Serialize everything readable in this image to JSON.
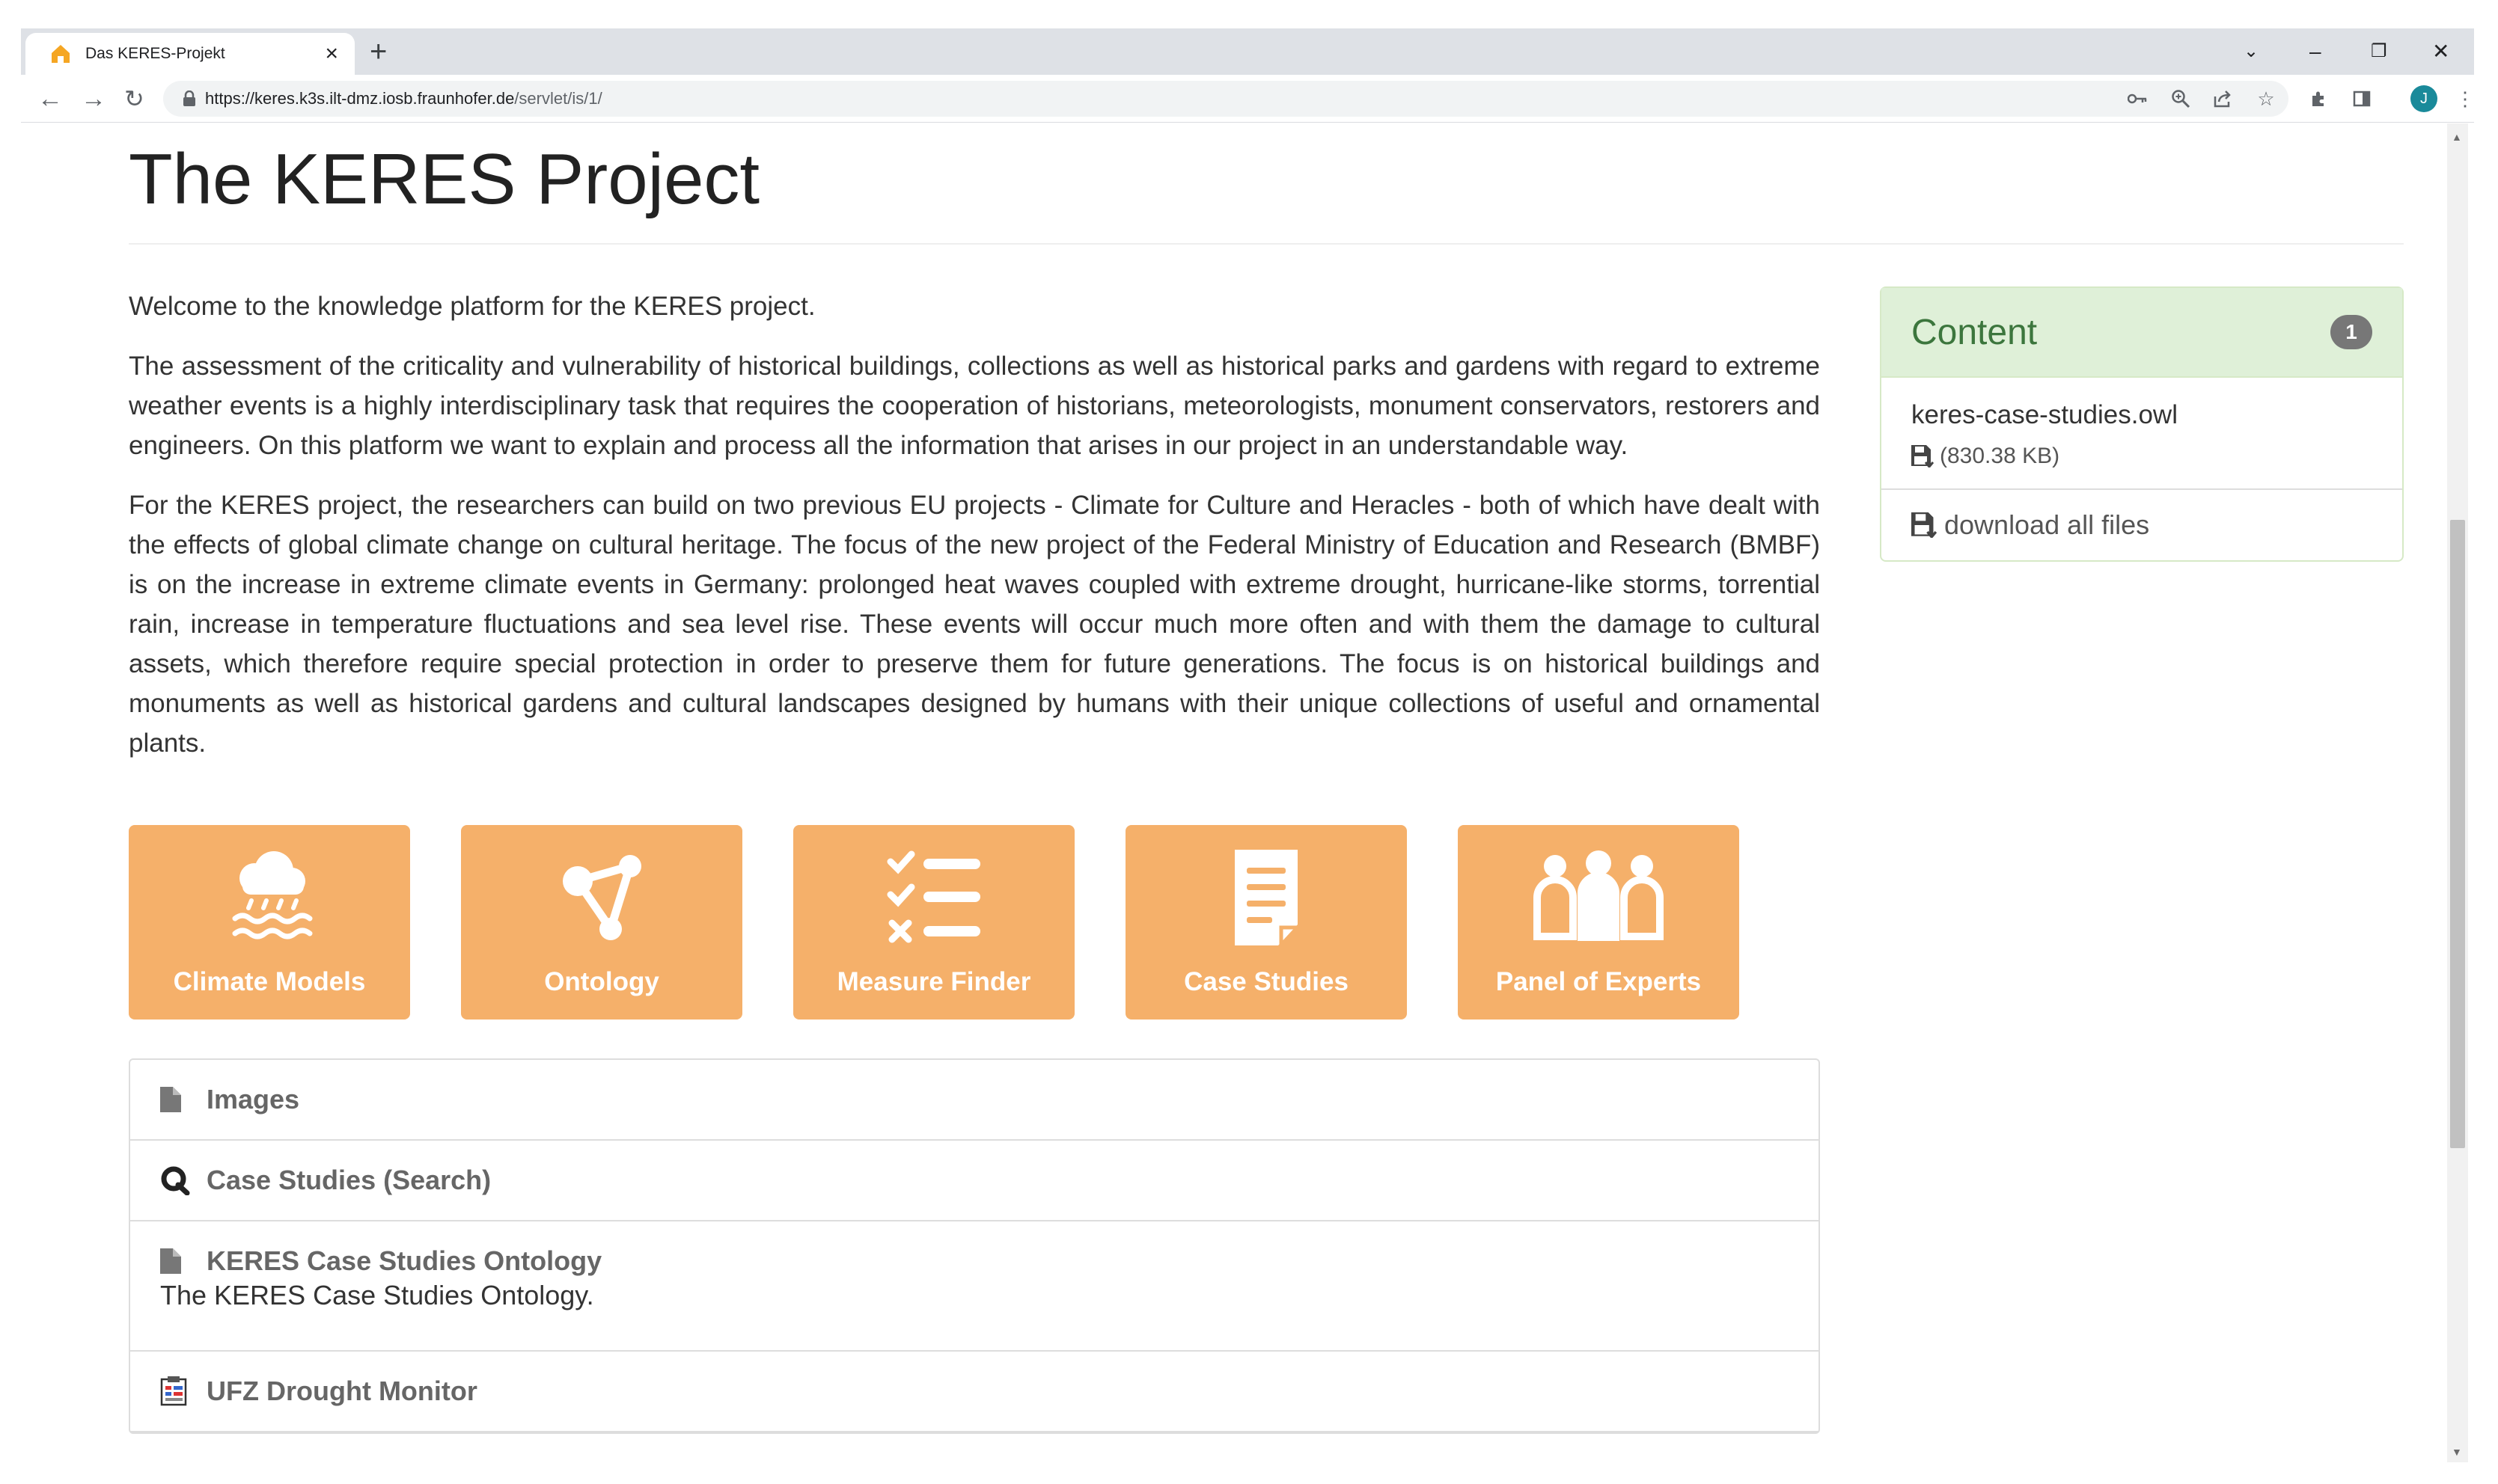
{
  "browser": {
    "tab_title": "Das KERES-Projekt",
    "url_host": "https://keres.k3s.ilt-dmz.iosb.fraunhofer.de",
    "url_path": "/servlet/is/1/",
    "avatar_letter": "J"
  },
  "page": {
    "title": "The KERES Project",
    "paragraphs": [
      "Welcome to the knowledge platform for the KERES project.",
      "The assessment of the criticality and vulnerability of historical buildings, collections as well as historical parks and gardens with regard to extreme weather events is a highly interdisciplinary task that requires the cooperation of historians, meteorologists, monument conservators, restorers and engineers. On this platform we want to explain and process all the information that arises in our project in an understandable way.",
      "For the KERES project, the researchers can build on two previous EU projects - Climate for Culture and Heracles - both of which have dealt with the effects of global climate change on cultural heritage. The focus of the new project of the Federal Ministry of Education and Research (BMBF) is on the increase in extreme climate events in Germany: prolonged heat waves coupled with extreme drought, hurricane-like storms, torrential rain, increase in temperature fluctuations and sea level rise. These events will occur much more often and with them the damage to cultural assets, which therefore require special protection in order to preserve them for future generations. The focus is on historical buildings and monuments as well as historical gardens and cultural landscapes designed by humans with their unique collections of useful and ornamental plants."
    ],
    "tiles": [
      {
        "label": "Climate Models",
        "icon": "climate-icon"
      },
      {
        "label": "Ontology",
        "icon": "ontology-icon"
      },
      {
        "label": "Measure Finder",
        "icon": "checklist-icon"
      },
      {
        "label": "Case Studies",
        "icon": "document-icon"
      },
      {
        "label": "Panel of Experts",
        "icon": "people-icon"
      }
    ],
    "list": [
      {
        "title": "Images",
        "icon": "file-icon"
      },
      {
        "title": "Case Studies (Search)",
        "icon": "search-q-icon"
      },
      {
        "title": "KERES Case Studies Ontology",
        "description": "The KERES Case Studies Ontology.",
        "icon": "file-icon"
      },
      {
        "title": "UFZ Drought Monitor",
        "icon": "report-icon"
      }
    ],
    "tile_color": "#f5b06a"
  },
  "panel": {
    "title": "Content",
    "badge": "1",
    "file_name": "keres-case-studies.owl",
    "file_size": "(830.38 KB)",
    "download_label": "download all files",
    "header_color": "#dff0d8",
    "title_color": "#3c763d"
  }
}
